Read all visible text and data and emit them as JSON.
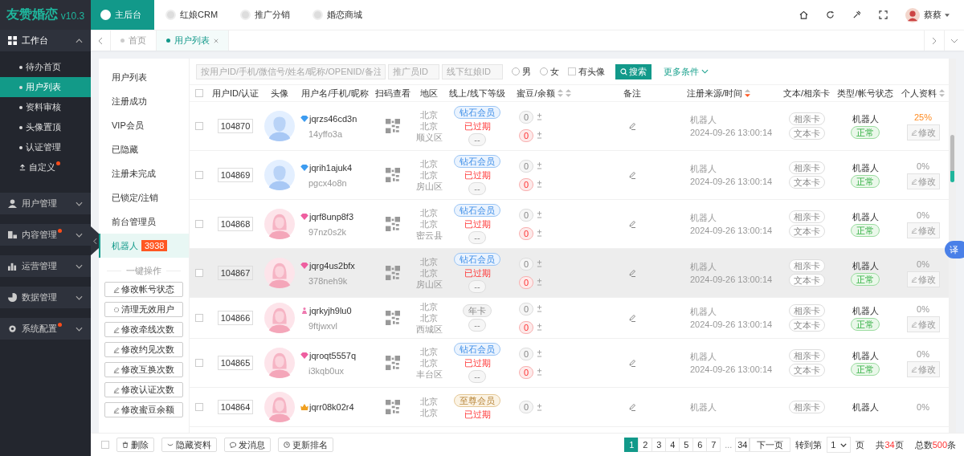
{
  "app": {
    "name": "友赞婚恋",
    "version": "v10.3"
  },
  "top_nav": [
    {
      "label": "主后台",
      "selected": true
    },
    {
      "label": "红娘CRM",
      "selected": false
    },
    {
      "label": "推广分销",
      "selected": false
    },
    {
      "label": "婚恋商城",
      "selected": false
    }
  ],
  "user": {
    "name": "蔡蔡"
  },
  "sidebar": [
    {
      "label": "工作台",
      "expanded": true,
      "dot": false,
      "children": [
        {
          "label": "待办首页",
          "kind": "bullet",
          "selected": false,
          "dot": false
        },
        {
          "label": "用户列表",
          "kind": "bullet",
          "selected": true,
          "dot": false
        },
        {
          "label": "资料审核",
          "kind": "bullet",
          "selected": false,
          "dot": false
        },
        {
          "label": "头像置顶",
          "kind": "bullet",
          "selected": false,
          "dot": false
        },
        {
          "label": "认证管理",
          "kind": "bullet",
          "selected": false,
          "dot": false
        },
        {
          "label": "自定义",
          "kind": "icon",
          "selected": false,
          "dot": true
        }
      ]
    },
    {
      "label": "用户管理",
      "expanded": false,
      "dot": false
    },
    {
      "label": "内容管理",
      "expanded": false,
      "dot": true
    },
    {
      "label": "运营管理",
      "expanded": false,
      "dot": false
    },
    {
      "label": "数据管理",
      "expanded": false,
      "dot": false
    },
    {
      "label": "系统配置",
      "expanded": false,
      "dot": true
    }
  ],
  "tabs": [
    {
      "label": "首页",
      "selected": false,
      "closable": false
    },
    {
      "label": "用户列表",
      "selected": true,
      "closable": true
    }
  ],
  "submenu": {
    "items": [
      {
        "label": "用户列表",
        "selected": false
      },
      {
        "label": "注册成功",
        "selected": false
      },
      {
        "label": "VIP会员",
        "selected": false
      },
      {
        "label": "已隐藏",
        "selected": false
      },
      {
        "label": "注册未完成",
        "selected": false
      },
      {
        "label": "已锁定/注销",
        "selected": false
      },
      {
        "label": "前台管理员",
        "selected": false
      },
      {
        "label": "机器人",
        "selected": true,
        "count": "3938"
      }
    ],
    "actions_title": "一键操作",
    "actions": [
      {
        "label": "修改帐号状态",
        "kind": "edit"
      },
      {
        "label": "清理无效用户",
        "kind": "clean"
      },
      {
        "label": "修改牵线次数",
        "kind": "edit"
      },
      {
        "label": "修改约见次数",
        "kind": "edit"
      },
      {
        "label": "修改互换次数",
        "kind": "edit"
      },
      {
        "label": "修改认证次数",
        "kind": "edit"
      },
      {
        "label": "修改蜜豆余额",
        "kind": "edit"
      }
    ]
  },
  "search": {
    "fields": [
      {
        "placeholder": "按用户ID/手机/微信号/姓名/昵称/OPENID/备注"
      },
      {
        "placeholder": "推广员ID"
      },
      {
        "placeholder": "线下红娘ID"
      }
    ],
    "radios": [
      {
        "label": "男",
        "checked": false
      },
      {
        "label": "女",
        "checked": false
      }
    ],
    "checkbox": {
      "label": "有头像",
      "checked": false
    },
    "button": "搜索",
    "more": "更多条件"
  },
  "table": {
    "select_all": {
      "checked": false
    },
    "columns": [
      {
        "label": "用户ID/认证"
      },
      {
        "label": "头像"
      },
      {
        "label": "用户名/手机/昵称"
      },
      {
        "label": "扫码查看"
      },
      {
        "label": "地区"
      },
      {
        "label": "线上/线下等级"
      },
      {
        "label": "蜜豆/余额",
        "sorts": [
          {
            "active": false
          },
          {
            "active": false
          }
        ]
      },
      {
        "label": "备注"
      },
      {
        "label": "注册来源/时间",
        "sorts": [
          {
            "active": true
          }
        ]
      },
      {
        "label": "文本/相亲卡"
      },
      {
        "label": "类型/帐号状态"
      },
      {
        "label": "个人资料",
        "sorts": [
          {
            "active": false
          }
        ]
      }
    ],
    "rows": [
      {
        "checked": false,
        "highlighted": false,
        "id": "104870",
        "female": false,
        "badge": {
          "kind": "diamond",
          "color": "#3d9cf0"
        },
        "name": "jqrzs46cd3n",
        "nickname": "14yffo3a",
        "region": [
          "北京",
          "北京",
          "顺义区"
        ],
        "tier": {
          "label": "钻石会员",
          "kind": "diamond"
        },
        "expired": "已过期",
        "extra": "--",
        "beans": "0",
        "balance": "0",
        "source": "机器人",
        "time": "2024-09-26 13:00:14",
        "cards": [
          "相亲卡",
          "文本卡"
        ],
        "type": "机器人",
        "status": "正常",
        "profile": "25%",
        "profile_highlight": true,
        "edit": "修改"
      },
      {
        "checked": false,
        "highlighted": false,
        "id": "104869",
        "female": false,
        "badge": {
          "kind": "diamond",
          "color": "#3d9cf0"
        },
        "name": "jqrih1ajuk4",
        "nickname": "pgcx4o8n",
        "region": [
          "北京",
          "北京",
          "房山区"
        ],
        "tier": {
          "label": "钻石会员",
          "kind": "diamond"
        },
        "expired": "已过期",
        "extra": "--",
        "beans": "0",
        "balance": "0",
        "source": "机器人",
        "time": "2024-09-26 13:00:14",
        "cards": [
          "相亲卡",
          "文本卡"
        ],
        "type": "机器人",
        "status": "正常",
        "profile": "0%",
        "profile_highlight": false,
        "edit": "修改"
      },
      {
        "checked": false,
        "highlighted": false,
        "id": "104868",
        "female": true,
        "badge": {
          "kind": "diamond",
          "color": "#ee5fa0"
        },
        "name": "jqrf8unp8f3",
        "nickname": "97nz0s2k",
        "region": [
          "北京",
          "北京",
          "密云县"
        ],
        "tier": {
          "label": "钻石会员",
          "kind": "diamond"
        },
        "expired": "已过期",
        "extra": "--",
        "beans": "0",
        "balance": "0",
        "source": "机器人",
        "time": "2024-09-26 13:00:14",
        "cards": [
          "相亲卡",
          "文本卡"
        ],
        "type": "机器人",
        "status": "正常",
        "profile": "0%",
        "profile_highlight": false,
        "edit": "修改"
      },
      {
        "checked": false,
        "highlighted": true,
        "id": "104867",
        "female": true,
        "badge": {
          "kind": "diamond",
          "color": "#ee5fa0"
        },
        "name": "jqrg4us2bfx",
        "nickname": "378neh9k",
        "region": [
          "北京",
          "北京",
          "房山区"
        ],
        "tier": {
          "label": "钻石会员",
          "kind": "diamond"
        },
        "expired": "已过期",
        "extra": "--",
        "beans": "0",
        "balance": "0",
        "source": "机器人",
        "time": "2024-09-26 13:00:14",
        "cards": [
          "相亲卡",
          "文本卡"
        ],
        "type": "机器人",
        "status": "正常",
        "profile": "0%",
        "profile_highlight": false,
        "edit": "修改"
      },
      {
        "checked": false,
        "highlighted": false,
        "id": "104866",
        "female": true,
        "badge": {
          "kind": "figure",
          "color": "#ee7ab0"
        },
        "name": "jqrkyjh9lu0",
        "nickname": "9ftjwxvl",
        "region": [
          "北京",
          "北京",
          "西城区"
        ],
        "tier": {
          "label": "年卡",
          "kind": "plain"
        },
        "extra": "--",
        "beans": "0",
        "balance": "0",
        "source": "机器人",
        "time": "2024-09-26 13:00:14",
        "cards": [
          "相亲卡",
          "文本卡"
        ],
        "type": "机器人",
        "status": "正常",
        "profile": "0%",
        "profile_highlight": false,
        "edit": "修改"
      },
      {
        "checked": false,
        "highlighted": false,
        "id": "104865",
        "female": true,
        "badge": {
          "kind": "diamond",
          "color": "#ee5fa0"
        },
        "name": "jqroqt5557q",
        "nickname": "i3kqb0ux",
        "region": [
          "北京",
          "北京",
          "丰台区"
        ],
        "tier": {
          "label": "钻石会员",
          "kind": "diamond"
        },
        "expired": "已过期",
        "extra": "--",
        "beans": "0",
        "balance": "0",
        "source": "机器人",
        "time": "2024-09-26 13:00:14",
        "cards": [
          "相亲卡",
          "文本卡"
        ],
        "type": "机器人",
        "status": "正常",
        "profile": "0%",
        "profile_highlight": false,
        "edit": "修改"
      },
      {
        "checked": false,
        "highlighted": false,
        "id": "104864",
        "female": true,
        "badge": {
          "kind": "crown",
          "color": "#f0a020"
        },
        "name": "jqrr08k02r4",
        "region": [
          "北京",
          "北京"
        ],
        "tier": {
          "label": "至尊会员",
          "kind": "supreme"
        },
        "expired": "已过期",
        "beans": "0",
        "source": "机器人",
        "cards": [
          "相亲卡"
        ],
        "type": "机器人",
        "profile": "0%",
        "profile_highlight": false
      }
    ]
  },
  "footer": {
    "select_all": {
      "checked": false
    },
    "actions": [
      "删除",
      "隐藏资料",
      "发消息",
      "更新排名"
    ],
    "pages": [
      {
        "label": "1",
        "kind": "page",
        "selected": true
      },
      {
        "label": "2",
        "kind": "page",
        "selected": false
      },
      {
        "label": "3",
        "kind": "page",
        "selected": false
      },
      {
        "label": "4",
        "kind": "page",
        "selected": false
      },
      {
        "label": "5",
        "kind": "page",
        "selected": false
      },
      {
        "label": "6",
        "kind": "page",
        "selected": false
      },
      {
        "label": "7",
        "kind": "page",
        "selected": false
      },
      {
        "label": "...",
        "kind": "gap",
        "selected": false
      },
      {
        "label": "34",
        "kind": "page",
        "selected": false
      }
    ],
    "next": "下一页",
    "goto": {
      "prefix": "转到第",
      "value": "1",
      "suffix": "页"
    },
    "total_pages": {
      "prefix": "共",
      "value": "34",
      "suffix": "页"
    },
    "total": {
      "prefix": "总数",
      "value": "500",
      "suffix": "条"
    }
  },
  "translate": "译"
}
